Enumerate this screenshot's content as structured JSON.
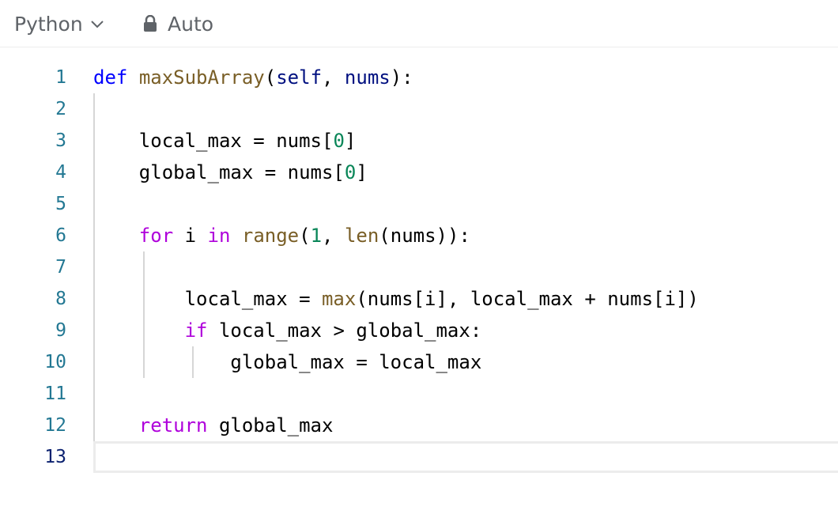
{
  "toolbar": {
    "language": "Python",
    "mode": "Auto",
    "icons": {
      "dropdown": "chevron-down-icon",
      "lock": "lock-icon"
    }
  },
  "editor": {
    "line_numbers": [
      "1",
      "2",
      "3",
      "4",
      "5",
      "6",
      "7",
      "8",
      "9",
      "10",
      "11",
      "12",
      "13"
    ],
    "active_line": 13,
    "lines": [
      [
        {
          "t": "def",
          "c": "kw"
        },
        {
          "t": " "
        },
        {
          "t": "maxSubArray",
          "c": "fn"
        },
        {
          "t": "("
        },
        {
          "t": "self",
          "c": "param"
        },
        {
          "t": ", "
        },
        {
          "t": "nums",
          "c": "param"
        },
        {
          "t": "):"
        }
      ],
      [],
      [
        {
          "t": "    local_max = nums["
        },
        {
          "t": "0",
          "c": "num"
        },
        {
          "t": "]"
        }
      ],
      [
        {
          "t": "    global_max = nums["
        },
        {
          "t": "0",
          "c": "num"
        },
        {
          "t": "]"
        }
      ],
      [],
      [
        {
          "t": "    "
        },
        {
          "t": "for",
          "c": "ctl"
        },
        {
          "t": " i "
        },
        {
          "t": "in",
          "c": "ctl"
        },
        {
          "t": " "
        },
        {
          "t": "range",
          "c": "fn"
        },
        {
          "t": "("
        },
        {
          "t": "1",
          "c": "num"
        },
        {
          "t": ", "
        },
        {
          "t": "len",
          "c": "fn"
        },
        {
          "t": "(nums)):"
        }
      ],
      [],
      [
        {
          "t": "        local_max = "
        },
        {
          "t": "max",
          "c": "fn"
        },
        {
          "t": "(nums[i], local_max + nums[i])"
        }
      ],
      [
        {
          "t": "        "
        },
        {
          "t": "if",
          "c": "ctl"
        },
        {
          "t": " local_max > global_max:"
        }
      ],
      [
        {
          "t": "            global_max = local_max"
        }
      ],
      [],
      [
        {
          "t": "    "
        },
        {
          "t": "return",
          "c": "ctl"
        },
        {
          "t": " global_max"
        }
      ],
      []
    ]
  },
  "colors": {
    "keyword": "#0000ff",
    "function": "#795e26",
    "parameter": "#001080",
    "number": "#098658",
    "control": "#af00db",
    "line_number": "#237893",
    "active_line_number": "#0b216f"
  }
}
